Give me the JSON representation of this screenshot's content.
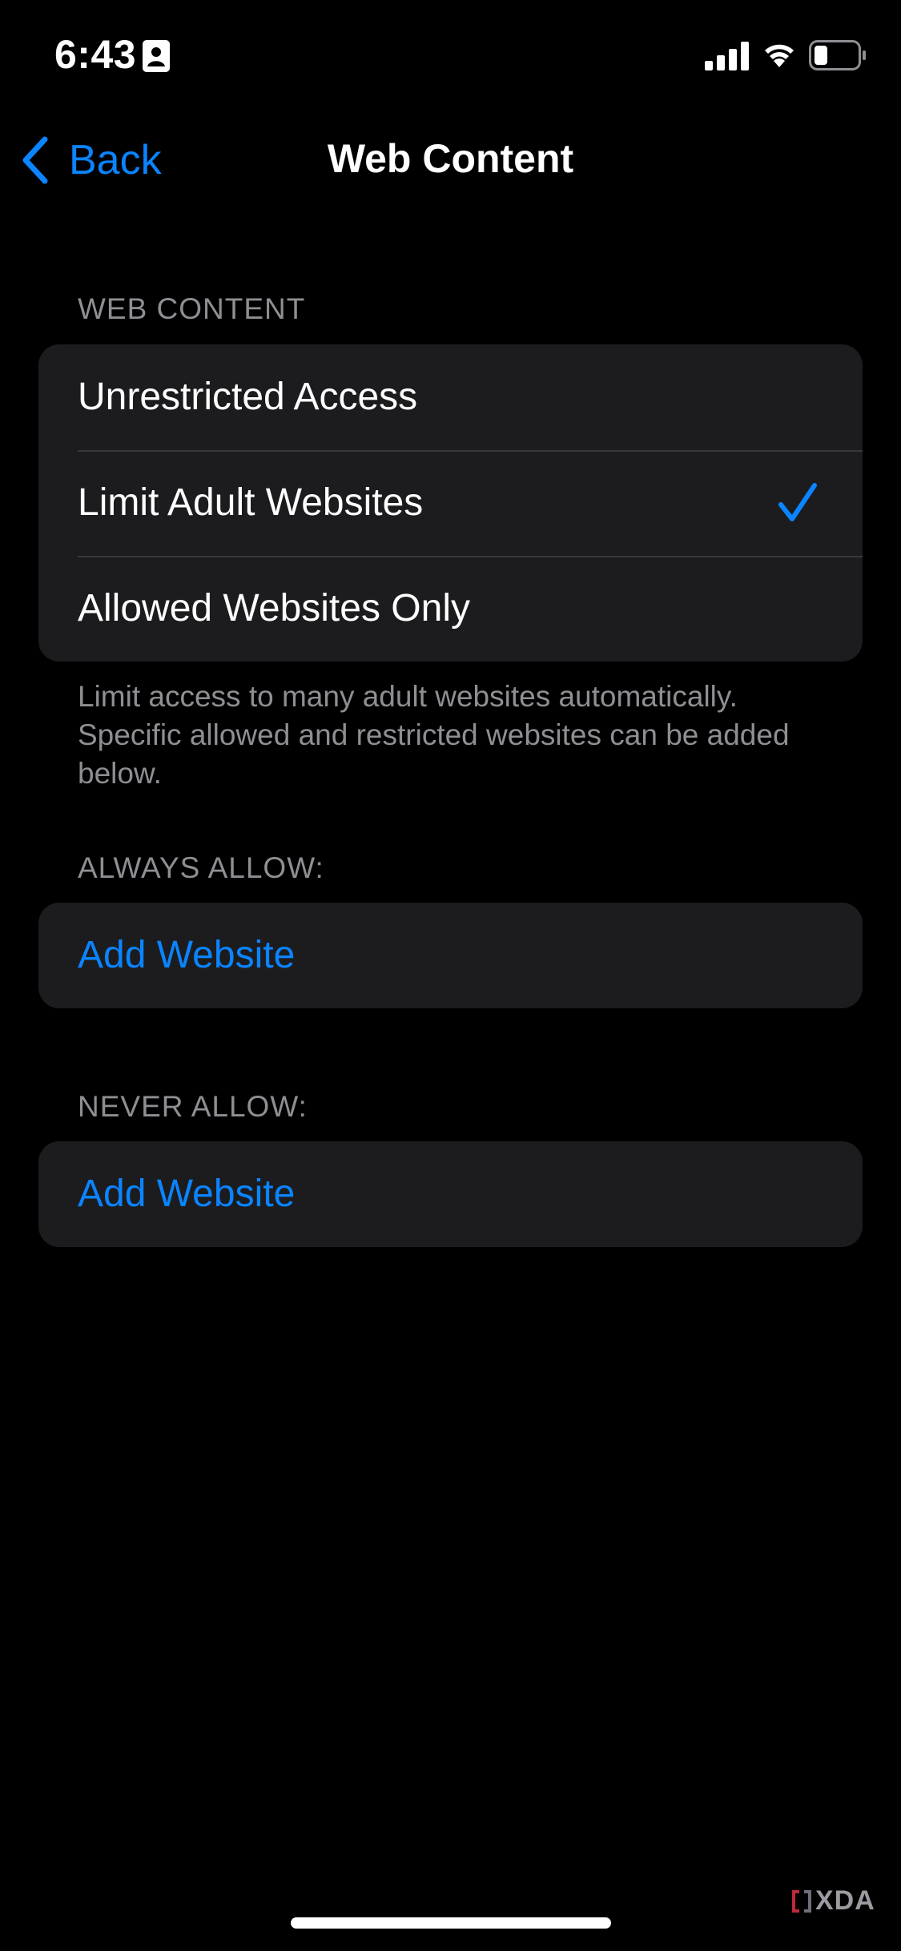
{
  "status_bar": {
    "time": "6:43",
    "icons": [
      "contact-card-icon",
      "cellular-signal-icon",
      "wifi-icon",
      "battery-icon"
    ]
  },
  "nav": {
    "back_label": "Back",
    "title": "Web Content"
  },
  "web_content": {
    "header": "WEB CONTENT",
    "options": [
      {
        "label": "Unrestricted Access",
        "selected": false
      },
      {
        "label": "Limit Adult Websites",
        "selected": true
      },
      {
        "label": "Allowed Websites Only",
        "selected": false
      }
    ],
    "footer": "Limit access to many adult websites automatically. Specific allowed and restricted websites can be added below."
  },
  "always_allow": {
    "header": "ALWAYS ALLOW:",
    "add_label": "Add Website"
  },
  "never_allow": {
    "header": "NEVER ALLOW:",
    "add_label": "Add Website"
  },
  "watermark": {
    "text": "XDA"
  },
  "colors": {
    "background": "#000000",
    "group_background": "#1c1c1e",
    "accent": "#0a84ff",
    "secondary_text": "#8e8e93",
    "separator": "#38383a"
  }
}
